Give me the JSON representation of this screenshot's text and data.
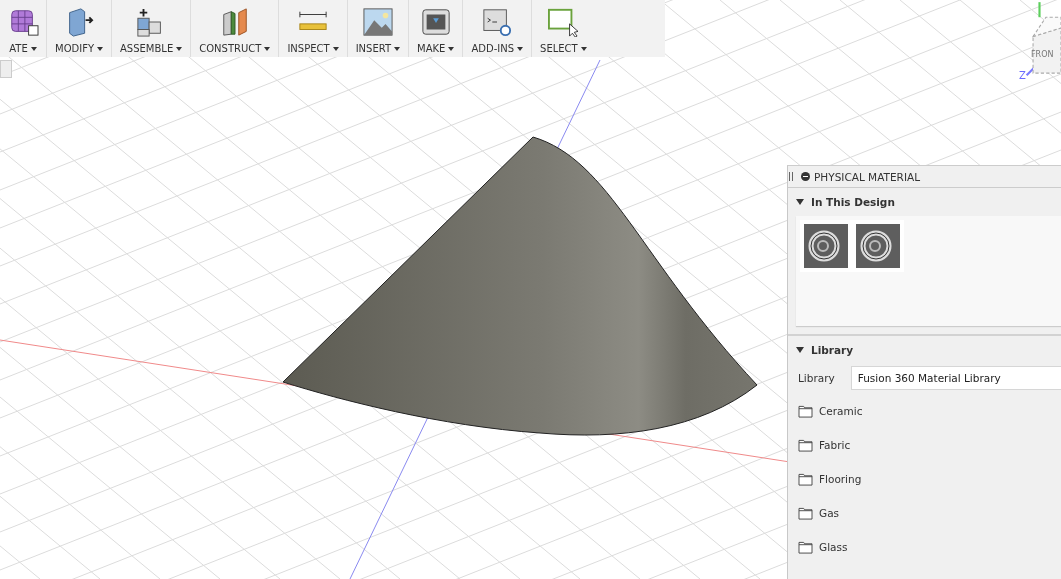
{
  "toolbar": {
    "groups": [
      {
        "label": "ATE",
        "kind": "create"
      },
      {
        "label": "MODIFY",
        "kind": "modify"
      },
      {
        "label": "ASSEMBLE",
        "kind": "assemble"
      },
      {
        "label": "CONSTRUCT",
        "kind": "construct"
      },
      {
        "label": "INSPECT",
        "kind": "inspect"
      },
      {
        "label": "INSERT",
        "kind": "insert"
      },
      {
        "label": "MAKE",
        "kind": "make"
      },
      {
        "label": "ADD-INS",
        "kind": "addins"
      },
      {
        "label": "SELECT",
        "kind": "select"
      }
    ]
  },
  "view_cube": {
    "front": "FRON",
    "axis": "Z"
  },
  "panel": {
    "title": "PHYSICAL MATERIAL",
    "in_this_design": {
      "title": "In This Design",
      "expanded": true,
      "materials": [
        {
          "selected": false
        },
        {
          "selected": false
        }
      ]
    },
    "library": {
      "title": "Library",
      "expanded": true,
      "field_label": "Library",
      "value": "Fusion 360 Material Library",
      "folders": [
        "Ceramic",
        "Fabric",
        "Flooring",
        "Gas",
        "Glass"
      ]
    }
  }
}
